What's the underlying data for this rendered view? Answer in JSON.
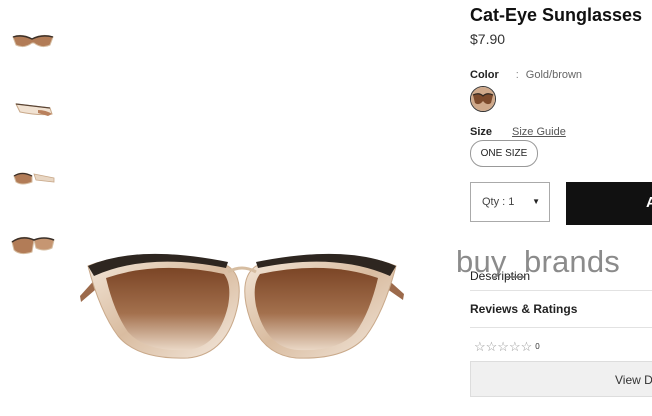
{
  "product": {
    "title": "Cat-Eye Sunglasses",
    "price": "$7.90",
    "image_alt": "Cat-Eye Sunglasses"
  },
  "color": {
    "label": "Color",
    "separator": ":",
    "value": "Gold/brown",
    "swatch_icon": "sunglasses-swatch-icon"
  },
  "size": {
    "label": "Size",
    "guide_link": "Size Guide",
    "selected": "ONE SIZE"
  },
  "quantity": {
    "label": "Qty : 1"
  },
  "add_button": {
    "label_visible": "A"
  },
  "watermark": "buy_brands",
  "sections": {
    "description": "Description",
    "reviews": "Reviews & Ratings"
  },
  "rating": {
    "stars_filled": 0,
    "stars_total": 5,
    "stars_text": "☆☆☆☆☆",
    "count": "0"
  },
  "view_button": {
    "label": "View D"
  },
  "colors": {
    "frame_gold": "#d9bfa3",
    "lens_brown": "#8a5433",
    "brow_dark": "#2e2620",
    "button_dark": "#111111"
  }
}
